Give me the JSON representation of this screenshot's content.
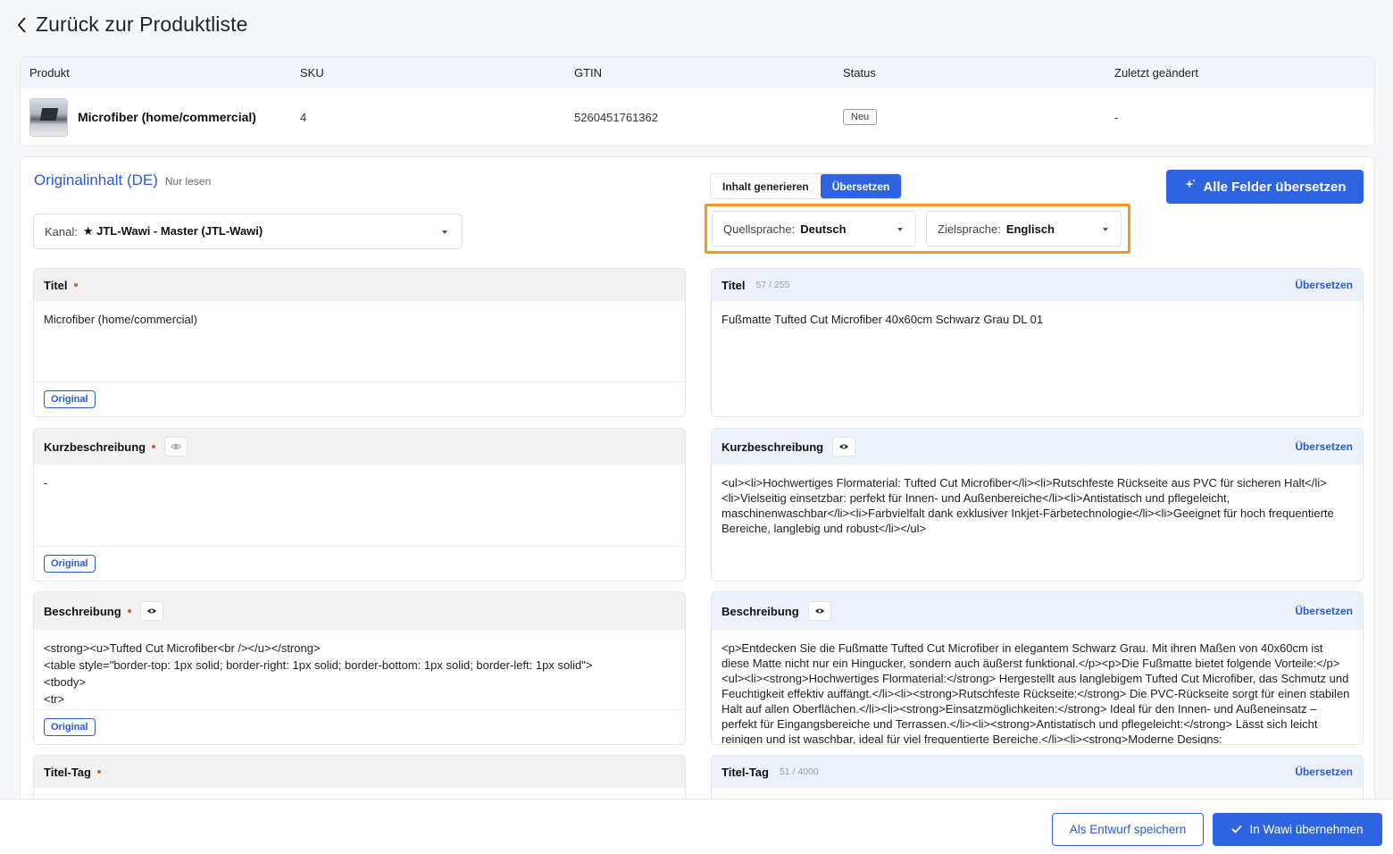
{
  "back_label": "Zurück zur Produktliste",
  "product_table": {
    "headers": [
      "Produkt",
      "SKU",
      "GTIN",
      "Status",
      "Zuletzt geändert"
    ],
    "row": {
      "name": "Microfiber (home/commercial)",
      "sku": "4",
      "gtin": "5260451761362",
      "status": "Neu",
      "modified": "-"
    }
  },
  "original": {
    "title": "Originalinhalt (DE)",
    "readonly": "Nur lesen",
    "channel_label": "Kanal:",
    "channel_value": "★ JTL-Wawi - Master (JTL-Wawi)",
    "badge": "Original",
    "fields": {
      "titel": {
        "label": "Titel",
        "value": "Microfiber (home/commercial)"
      },
      "kurz": {
        "label": "Kurzbeschreibung",
        "value": "-"
      },
      "beschr": {
        "label": "Beschreibung",
        "lines": [
          "<strong><u>Tufted Cut Microfiber<br /></u></strong>",
          "<table style=\"border-top: 1px solid; border-right: 1px solid; border-bottom: 1px solid; border-left: 1px solid\">",
          "<tbody>",
          "<tr>"
        ]
      },
      "titeltag": {
        "label": "Titel-Tag"
      }
    }
  },
  "mode_tabs": {
    "generate": "Inhalt generieren",
    "translate": "Übersetzen"
  },
  "translate_all": "Alle Felder übersetzen",
  "source_lang": {
    "label": "Quellsprache:",
    "value": "Deutsch"
  },
  "target_lang": {
    "label": "Zielsprache:",
    "value": "Englisch"
  },
  "translated": {
    "translate_link": "Übersetzen",
    "titel": {
      "label": "Titel",
      "counter": "57 / 255",
      "value": "Fußmatte Tufted Cut Microfiber 40x60cm Schwarz Grau DL 01"
    },
    "kurz": {
      "label": "Kurzbeschreibung",
      "value": "<ul><li>Hochwertiges Flormaterial: Tufted Cut Microfiber</li><li>Rutschfeste Rückseite aus PVC für sicheren Halt</li><li>Vielseitig einsetzbar: perfekt für Innen- und Außenbereiche</li><li>Antistatisch und pflegeleicht, maschinenwaschbar</li><li>Farbvielfalt dank exklusiver Inkjet-Färbetechnologie</li><li>Geeignet für hoch frequentierte Bereiche, langlebig und robust</li></ul>"
    },
    "beschr": {
      "label": "Beschreibung",
      "value": "<p>Entdecken Sie die Fußmatte Tufted Cut Microfiber in elegantem Schwarz Grau. Mit ihren Maßen von 40x60cm ist diese Matte nicht nur ein Hingucker, sondern auch äußerst funktional.</p><p>Die Fußmatte bietet folgende Vorteile:</p><ul><li><strong>Hochwertiges Flormaterial:</strong> Hergestellt aus langlebigem Tufted Cut Microfiber, das Schmutz und Feuchtigkeit effektiv auffängt.</li><li><strong>Rutschfeste Rückseite:</strong> Die PVC-Rückseite sorgt für einen stabilen Halt auf allen Oberflächen.</li><li><strong>Einsatzmöglichkeiten:</strong> Ideal für den Innen- und Außeneinsatz – perfekt für Eingangsbereiche und Terrassen.</li><li><strong>Antistatisch und pflegeleicht:</strong> Lässt sich leicht reinigen und ist waschbar, ideal für viel frequentierte Bereiche.</li><li><strong>Moderne Designs:"
    },
    "titeltag": {
      "label": "Titel-Tag",
      "counter": "51 / 4000"
    }
  },
  "footer": {
    "draft": "Als Entwurf speichern",
    "apply": "In Wawi übernehmen"
  },
  "colors": {
    "accent": "#2f64e0",
    "highlight": "#f39a1e",
    "required": "#e5562a"
  }
}
